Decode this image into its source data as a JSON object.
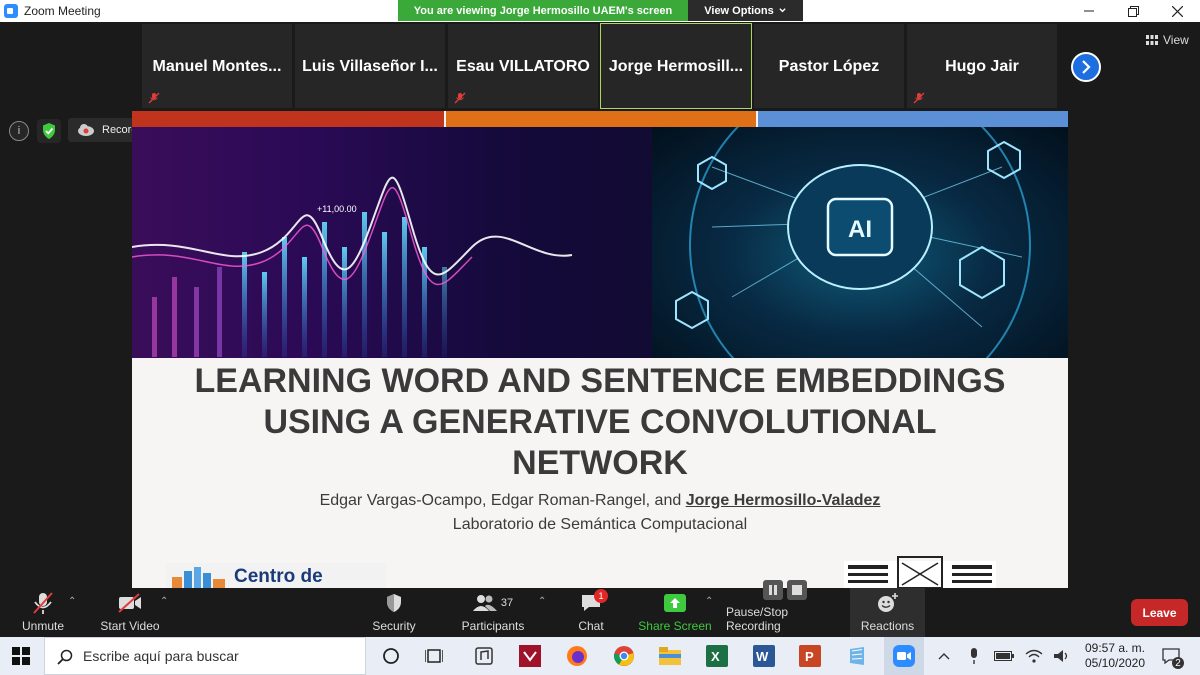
{
  "window": {
    "title": "Zoom Meeting",
    "banner_text": "You are viewing Jorge Hermosillo UAEM's screen",
    "view_options_label": "View Options",
    "view_label": "View"
  },
  "participants": [
    {
      "name": "Manuel  Montes...",
      "muted": true
    },
    {
      "name": "Luis  Villaseñor I...",
      "muted": false
    },
    {
      "name": "Esau VILLATORO",
      "muted": true
    },
    {
      "name": "Jorge  Hermosill...",
      "muted": false,
      "active": true
    },
    {
      "name": "Pastor López",
      "muted": false
    },
    {
      "name": "Hugo Jair",
      "muted": true
    }
  ],
  "recording": {
    "label": "Recording..."
  },
  "slide": {
    "title_lines": [
      "LEARNING WORD AND SENTENCE EMBEDDINGS",
      "USING A GENERATIVE CONVOLUTIONAL",
      "NETWORK"
    ],
    "authors_prefix": "Edgar Vargas-Ocampo, Edgar Roman-Rangel, and ",
    "authors_highlight": "Jorge Hermosillo-Valadez",
    "lab": "Laboratorio de Semántica Computacional",
    "chart_annotation": "+11,00.00",
    "ai_label": "AI",
    "logo_left_text": "Centro de",
    "stripe_colors": [
      "#c0331c",
      "#e07018",
      "#5b8fd6"
    ]
  },
  "toolbar": {
    "unmute": "Unmute",
    "start_video": "Start Video",
    "security": "Security",
    "participants": "Participants",
    "participants_count": "37",
    "chat": "Chat",
    "chat_badge": "1",
    "share_screen": "Share Screen",
    "pause_stop_recording": "Pause/Stop Recording",
    "reactions": "Reactions",
    "leave": "Leave",
    "share_color": "#3ec93e",
    "leave_color": "#c62828"
  },
  "taskbar": {
    "search_placeholder": "Escribe aquí para buscar",
    "time": "09:57 a. m.",
    "date": "05/10/2020",
    "notification_count": "2"
  }
}
